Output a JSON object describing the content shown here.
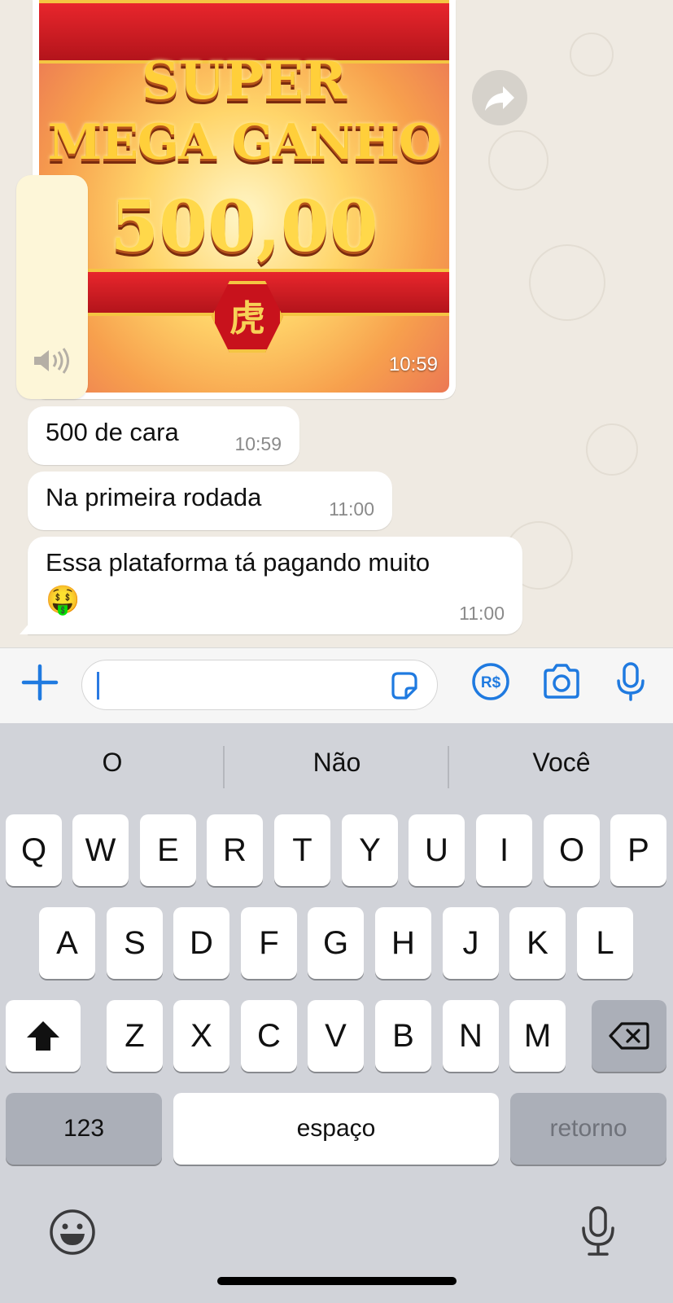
{
  "game_image": {
    "line1": "SUPER",
    "line2": "MEGA GANHO",
    "amount": "500,00",
    "emblem": "虎",
    "time": "10:59"
  },
  "messages": [
    {
      "text": "500 de cara",
      "time": "10:59"
    },
    {
      "text": "Na primeira rodada",
      "time": "11:00"
    },
    {
      "text": "Essa plataforma tá pagando muito",
      "emoji": "🤑",
      "time": "11:00"
    }
  ],
  "composer": {
    "input_value": "",
    "icons": [
      "plus-icon",
      "sticker-icon",
      "payment-icon",
      "camera-icon",
      "microphone-icon"
    ],
    "payment_label": "R$",
    "accent": "#1f7ae0"
  },
  "keyboard": {
    "suggestions": [
      "O",
      "Não",
      "Você"
    ],
    "row1": [
      "Q",
      "W",
      "E",
      "R",
      "T",
      "Y",
      "U",
      "I",
      "O",
      "P"
    ],
    "row2": [
      "A",
      "S",
      "D",
      "F",
      "G",
      "H",
      "J",
      "K",
      "L"
    ],
    "row3": [
      "Z",
      "X",
      "C",
      "V",
      "B",
      "N",
      "M"
    ],
    "numbers": "123",
    "space": "espaço",
    "return": "retorno"
  }
}
